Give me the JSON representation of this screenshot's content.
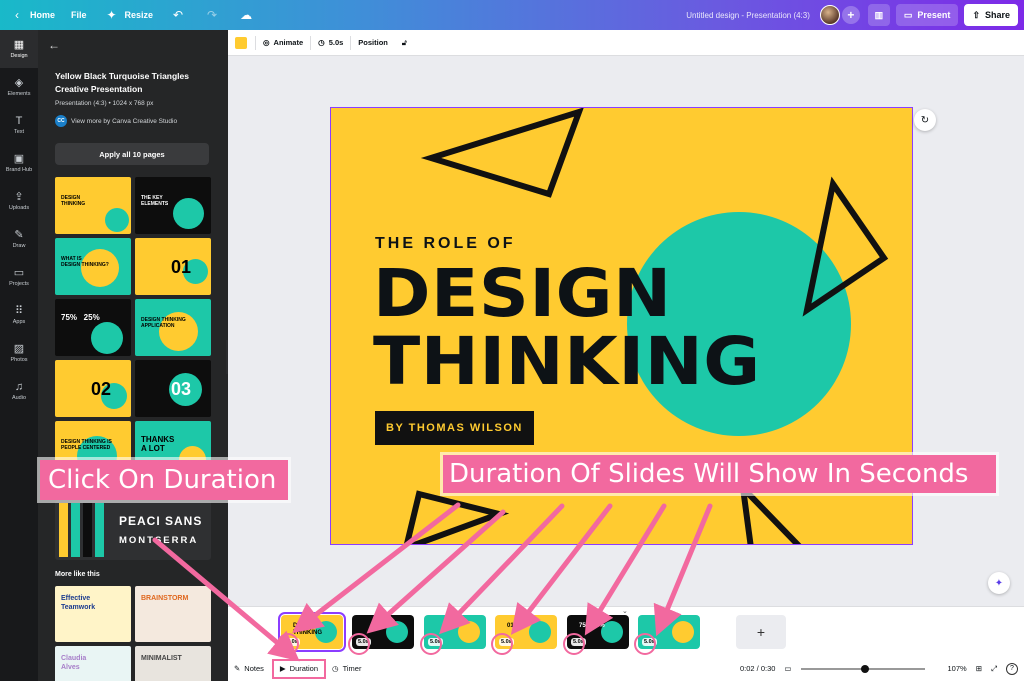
{
  "topbar": {
    "home": "Home",
    "file": "File",
    "resize": "Resize",
    "doc_title": "Untitled design - Presentation (4:3)",
    "present": "Present",
    "share": "Share"
  },
  "rail": [
    {
      "label": "Design",
      "icon": "layout-icon",
      "glyph": "▦"
    },
    {
      "label": "Elements",
      "icon": "shapes-icon",
      "glyph": "◈"
    },
    {
      "label": "Text",
      "icon": "text-icon",
      "glyph": "T"
    },
    {
      "label": "Brand Hub",
      "icon": "brand-icon",
      "glyph": "▣"
    },
    {
      "label": "Uploads",
      "icon": "upload-icon",
      "glyph": "⇪"
    },
    {
      "label": "Draw",
      "icon": "pen-icon",
      "glyph": "✎"
    },
    {
      "label": "Projects",
      "icon": "folder-icon",
      "glyph": "▭"
    },
    {
      "label": "Apps",
      "icon": "apps-icon",
      "glyph": "⠿"
    },
    {
      "label": "Photos",
      "icon": "photo-icon",
      "glyph": "▨"
    },
    {
      "label": "Audio",
      "icon": "music-icon",
      "glyph": "♫"
    }
  ],
  "panel": {
    "title": "Yellow Black Turquoise Triangles Creative Presentation",
    "subtitle": "Presentation (4:3) • 1024 x 768 px",
    "author_badge": "CC",
    "author": "View more by Canva Creative Studio",
    "apply": "Apply all 10 pages",
    "thumbs": [
      {
        "bg": "y",
        "text": "DESIGN\nTHINKING"
      },
      {
        "bg": "b",
        "text": "THE KEY\nELEMENTS"
      },
      {
        "bg": "t",
        "text": "WHAT IS\nDESIGN THINKING?"
      },
      {
        "bg": "y",
        "text": "01"
      },
      {
        "bg": "b",
        "text": "75%   25%"
      },
      {
        "bg": "t",
        "text": "DESIGN THINKING\nAPPLICATION"
      },
      {
        "bg": "y",
        "text": "02"
      },
      {
        "bg": "b",
        "text": "03"
      },
      {
        "bg": "y",
        "text": "DESIGN THINKING IS\nPEOPLE CENTERED"
      },
      {
        "bg": "t",
        "text": "THANKS\nA LOT"
      }
    ],
    "font_preview_1": "PEACI SANS",
    "font_preview_2": "MONTSERRA",
    "more_like": "More like this",
    "more": [
      {
        "text": "Effective\nTeamwork"
      },
      {
        "text": "BRAINSTORM"
      },
      {
        "text": "Claudia\nAlves"
      },
      {
        "text": "MINIMALIST"
      }
    ]
  },
  "toolbar": {
    "animate": "Animate",
    "duration": "5.0s",
    "position": "Position"
  },
  "slide": {
    "subtitle": "THE ROLE OF",
    "title_line1": "DESIGN",
    "title_line2": "THINKING",
    "byline": "BY THOMAS WILSON"
  },
  "filmstrip": [
    {
      "bg": "y",
      "duration": "5.0s",
      "label": "DESIGN THINKING"
    },
    {
      "bg": "b",
      "duration": "5.0s",
      "label": ""
    },
    {
      "bg": "t",
      "duration": "5.0s",
      "label": ""
    },
    {
      "bg": "y",
      "duration": "5.0s",
      "label": "01"
    },
    {
      "bg": "b",
      "duration": "5.0s",
      "label": "75%  25%"
    },
    {
      "bg": "t",
      "duration": "5.0s",
      "label": ""
    }
  ],
  "add_page": "+",
  "bottombar": {
    "notes": "Notes",
    "duration": "Duration",
    "timer": "Timer",
    "time": "0:02 / 0:30",
    "zoom": "107%",
    "help": "?"
  },
  "annotations": {
    "click_duration": "Click On Duration",
    "durations_show": "Duration Of Slides Will Show In Seconds"
  },
  "colors": {
    "yellow": "#ffcb30",
    "teal": "#1dc8a8",
    "black": "#0d0d0d",
    "accent": "#8b3dff",
    "callout": "#f2699f"
  }
}
